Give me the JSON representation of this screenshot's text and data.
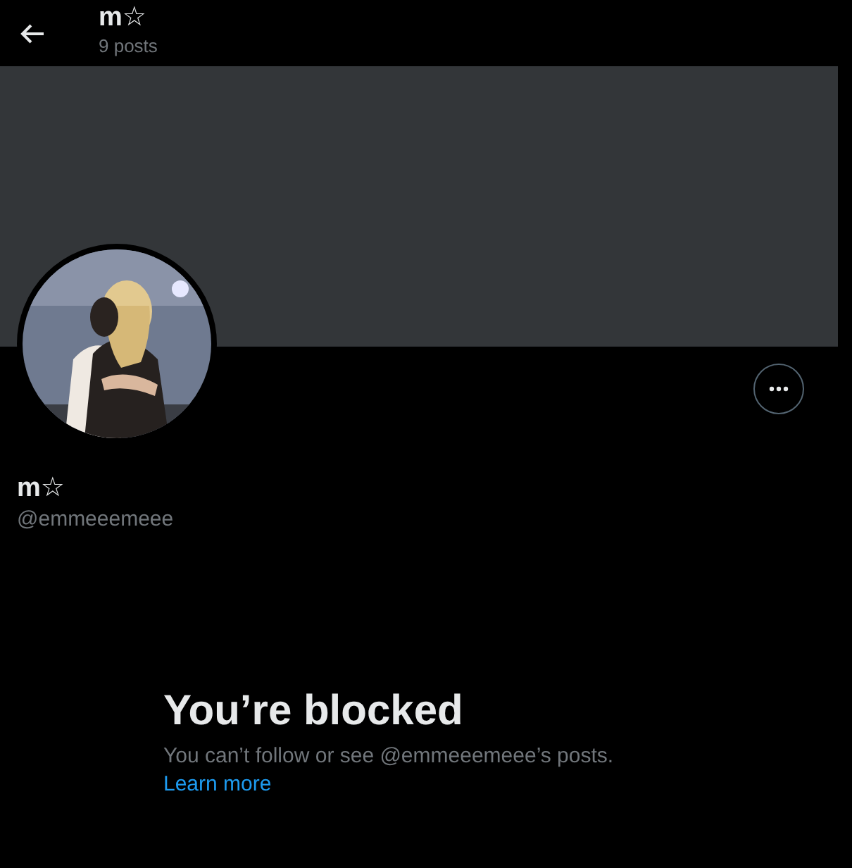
{
  "header": {
    "title": "m☆",
    "subtitle": "9 posts"
  },
  "profile": {
    "name": "m☆",
    "handle": "@emmeeemeee"
  },
  "blocked": {
    "title": "You’re blocked",
    "message": "You can’t follow or see @emmeeemeee’s posts.",
    "link": "Learn more"
  }
}
